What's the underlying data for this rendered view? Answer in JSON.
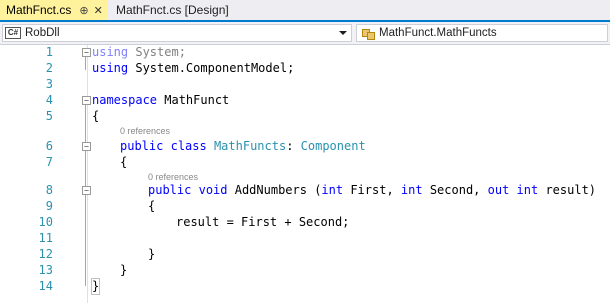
{
  "tabs": {
    "active": "MathFnct.cs",
    "active_pin": "⊕",
    "active_close": "✕",
    "inactive": "MathFnct.cs [Design]"
  },
  "navbar": {
    "project_icon": "C#",
    "project": "RobDll",
    "member": "MathFunct.MathFuncts"
  },
  "editor": {
    "line_numbers": [
      "1",
      "2",
      "3",
      "4",
      "5",
      "6",
      "7",
      "8",
      "9",
      "10",
      "11",
      "12",
      "13",
      "14"
    ],
    "codelens": {
      "class_refs": "0 references",
      "method_refs": "0 references"
    },
    "l1_kw": "using",
    "l1_rest": " System;",
    "l2_kw": "using",
    "l2_rest": " System.ComponentModel;",
    "l4_kw": "namespace",
    "l4_rest": " MathFunct",
    "l5": "{",
    "l6_kw1": "public",
    "l6_kw2": "class",
    "l6_name": "MathFuncts",
    "l6_colon": ": ",
    "l6_base": "Component",
    "l7": "{",
    "l8_kw1": "public",
    "l8_kw2": "void",
    "l8_name": " AddNumbers (",
    "l8_int1": "int",
    "l8_p1": " First, ",
    "l8_int2": "int",
    "l8_p2": " Second, ",
    "l8_out": "out",
    "l8_sp": " ",
    "l8_int3": "int",
    "l8_p3": " result)",
    "l9": "{",
    "l10": "result = First + Second;",
    "l12": "}",
    "l13": "}",
    "l14": "}"
  },
  "colors": {
    "keyword": "#0000ff",
    "type": "#2b91af",
    "line_number": "#2b91af",
    "active_tab": "#fff29d",
    "accent": "#007acc"
  }
}
